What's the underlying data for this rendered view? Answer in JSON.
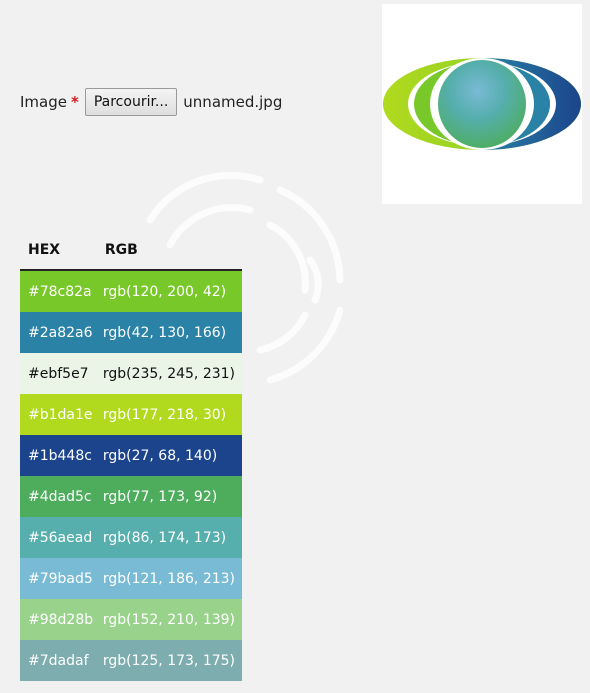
{
  "form": {
    "label": "Image",
    "required_mark": "*",
    "browse_button": "Parcourir...",
    "filename": "unnamed.jpg"
  },
  "table": {
    "headers": [
      "HEX",
      "RGB"
    ],
    "rows": [
      {
        "hex": "#78c82a",
        "rgb": "rgb(120, 200, 42)",
        "color": "#78c82a",
        "dark_text": false
      },
      {
        "hex": "#2a82a6",
        "rgb": "rgb(42, 130, 166)",
        "color": "#2a82a6",
        "dark_text": false
      },
      {
        "hex": "#ebf5e7",
        "rgb": "rgb(235, 245, 231)",
        "color": "#ebf5e7",
        "dark_text": true
      },
      {
        "hex": "#b1da1e",
        "rgb": "rgb(177, 218, 30)",
        "color": "#b1da1e",
        "dark_text": false
      },
      {
        "hex": "#1b448c",
        "rgb": "rgb(27, 68, 140)",
        "color": "#1b448c",
        "dark_text": false
      },
      {
        "hex": "#4dad5c",
        "rgb": "rgb(77, 173, 92)",
        "color": "#4dad5c",
        "dark_text": false
      },
      {
        "hex": "#56aead",
        "rgb": "rgb(86, 174, 173)",
        "color": "#56aead",
        "dark_text": false
      },
      {
        "hex": "#79bad5",
        "rgb": "rgb(121, 186, 213)",
        "color": "#79bad5",
        "dark_text": false
      },
      {
        "hex": "#98d28b",
        "rgb": "rgb(152, 210, 139)",
        "color": "#98d28b",
        "dark_text": false
      },
      {
        "hex": "#7dadaf",
        "rgb": "rgb(125, 173, 175)",
        "color": "#7dadaf",
        "dark_text": false
      }
    ]
  },
  "preview": {
    "icon": "uploaded-image-logo"
  }
}
